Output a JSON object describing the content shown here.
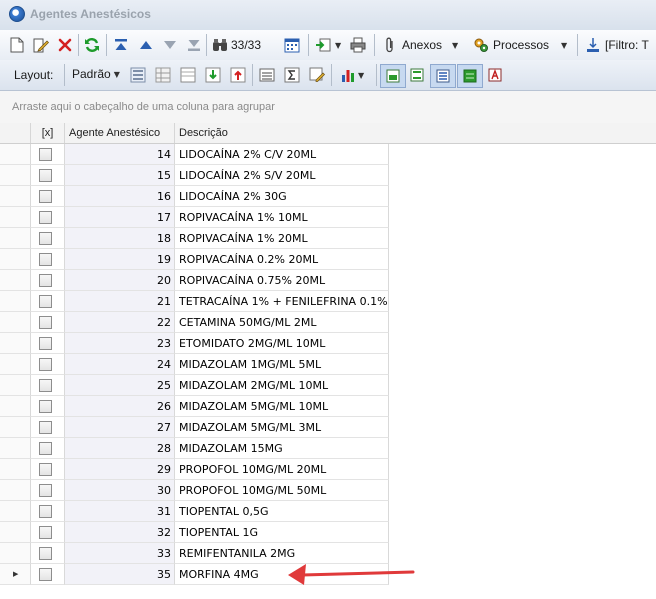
{
  "window": {
    "title": "Agentes Anestésicos"
  },
  "toolbar": {
    "record_counter": "33/33",
    "anexos_label": "Anexos",
    "processos_label": "Processos",
    "filtro_label": "[Filtro: T"
  },
  "toolbar2": {
    "layout_label": "Layout:",
    "layout_value": "Padrão"
  },
  "grouping": {
    "hint": "Arraste aqui o cabeçalho de uma coluna para agrupar"
  },
  "grid": {
    "columns": {
      "check": "[x]",
      "agente": "Agente Anestésico",
      "descricao": "Descrição"
    },
    "rows": [
      {
        "id": "14",
        "desc": "LIDOCAÍNA 2% C/V 20ML"
      },
      {
        "id": "15",
        "desc": "LIDOCAÍNA 2% S/V 20ML"
      },
      {
        "id": "16",
        "desc": "LIDOCAÍNA 2% 30G"
      },
      {
        "id": "17",
        "desc": "ROPIVACAÍNA 1% 10ML"
      },
      {
        "id": "18",
        "desc": "ROPIVACAÍNA 1% 20ML"
      },
      {
        "id": "19",
        "desc": "ROPIVACAÍNA 0.2% 20ML"
      },
      {
        "id": "20",
        "desc": "ROPIVACAÍNA 0.75% 20ML"
      },
      {
        "id": "21",
        "desc": "TETRACAÍNA 1% + FENILEFRINA 0.1% ..."
      },
      {
        "id": "22",
        "desc": "CETAMINA 50MG/ML 2ML"
      },
      {
        "id": "23",
        "desc": "ETOMIDATO 2MG/ML 10ML"
      },
      {
        "id": "24",
        "desc": "MIDAZOLAM 1MG/ML 5ML"
      },
      {
        "id": "25",
        "desc": "MIDAZOLAM 2MG/ML 10ML"
      },
      {
        "id": "26",
        "desc": "MIDAZOLAM 5MG/ML 10ML"
      },
      {
        "id": "27",
        "desc": "MIDAZOLAM 5MG/ML 3ML"
      },
      {
        "id": "28",
        "desc": "MIDAZOLAM 15MG"
      },
      {
        "id": "29",
        "desc": "PROPOFOL 10MG/ML 20ML"
      },
      {
        "id": "30",
        "desc": "PROPOFOL 10MG/ML 50ML"
      },
      {
        "id": "31",
        "desc": "TIOPENTAL 0,5G"
      },
      {
        "id": "32",
        "desc": "TIOPENTAL 1G"
      },
      {
        "id": "33",
        "desc": "REMIFENTANILA 2MG"
      },
      {
        "id": "35",
        "desc": "MORFINA 4MG"
      }
    ],
    "current_row_index": 20
  },
  "annotation": {
    "arrow_color": "#e0393a"
  }
}
